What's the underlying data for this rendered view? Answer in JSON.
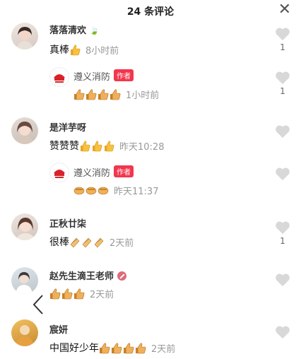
{
  "header": {
    "title": "24 条评论",
    "close_icon": "close-icon"
  },
  "comments": [
    {
      "name": "落落清欢",
      "text": "真棒",
      "time": "8小时前",
      "likes": "1",
      "emoji": "thumbs-up",
      "count": 1,
      "reply": {
        "name": "遵义消防",
        "badge": "作者",
        "text": "",
        "time": "1小时前",
        "likes": "1",
        "count": 4
      }
    },
    {
      "name": "是洋芋呀",
      "text": "赞赞赞",
      "time": "昨天10:28",
      "likes": "",
      "count": 3,
      "reply": {
        "name": "遵义消防",
        "badge": "作者",
        "text": "",
        "time": "昨天11:37",
        "likes": "",
        "count": 3
      }
    },
    {
      "name": "正秋廿柒",
      "text": "很棒",
      "time": "2天前",
      "likes": "1",
      "count": 3
    },
    {
      "name": "赵先生滴王老师",
      "text": "",
      "time": "2天前",
      "likes": "",
      "count": 3
    },
    {
      "name": "宸妍",
      "text": "中国好少年",
      "time": "2天前",
      "likes": "",
      "count": 4
    }
  ],
  "colors": {
    "badge": "#f2364d",
    "heart": "#d8d8d8",
    "time": "#999999"
  }
}
